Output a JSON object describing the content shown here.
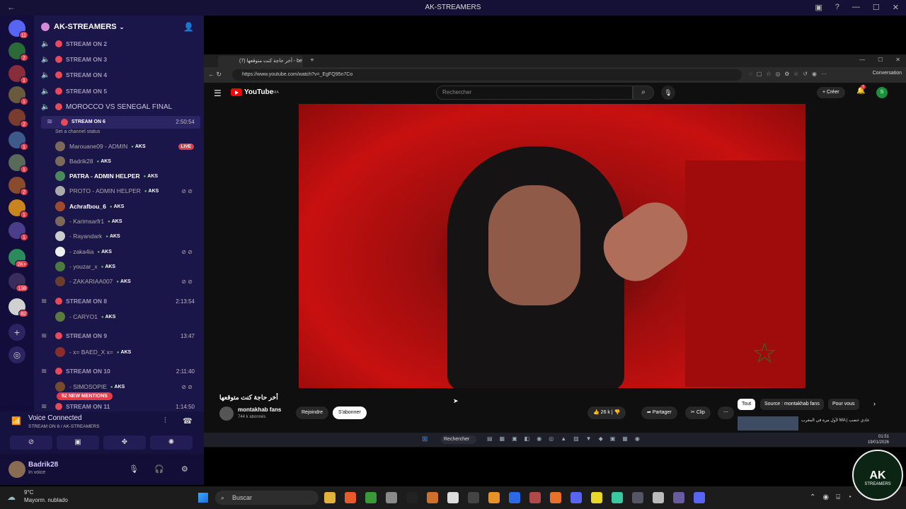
{
  "window": {
    "title": "AK-STREAMERS"
  },
  "servers": [
    {
      "badge": "11"
    },
    {
      "badge": "2"
    },
    {
      "badge": "1"
    },
    {
      "badge": "1"
    },
    {
      "badge": "2"
    },
    {
      "badge": "1"
    },
    {
      "badge": "1"
    },
    {
      "badge": "2"
    },
    {
      "badge": "1"
    },
    {
      "badge": "1"
    },
    {
      "badge": "2K+"
    },
    {
      "badge": "138"
    },
    {
      "badge": "82"
    }
  ],
  "guild": {
    "name": "AK-STREAMERS"
  },
  "channels": [
    {
      "name": "STREAM ON 2"
    },
    {
      "name": "STREAM ON 3"
    },
    {
      "name": "STREAM ON 4"
    },
    {
      "name": "STREAM ON 5"
    },
    {
      "name": "MOROCCO VS SENEGAL FINAL"
    }
  ],
  "active_channel": {
    "name": "STREAM ON 6",
    "time": "2:50:54",
    "status": "Set a channel status"
  },
  "users6": [
    {
      "name": "Marouane09 - ADMIN",
      "tag": "AKS",
      "live": "LIVE"
    },
    {
      "name": "Badrik28",
      "tag": "AKS"
    },
    {
      "name": "PATRA - ADMIN HELPER",
      "tag": "AKS"
    },
    {
      "name": "PROTO - ADMIN HELPER",
      "tag": "AKS"
    },
    {
      "name": "Achrafbou_6",
      "tag": "AKS"
    },
    {
      "name": "- Karimsarfr1",
      "tag": "AKS"
    },
    {
      "name": "- Rayandark",
      "tag": "AKS"
    },
    {
      "name": "- zaka4ia",
      "tag": "AKS"
    },
    {
      "name": "- youzar_x",
      "tag": "AKS"
    },
    {
      "name": "- ZAKARIAA007",
      "tag": "AKS"
    }
  ],
  "channel8": {
    "name": "STREAM ON 8",
    "time": "2:13:54",
    "user": "- CARYO1",
    "tag": "AKS"
  },
  "channel9": {
    "name": "STREAM ON 9",
    "time": "13:47",
    "user": "- x= BAED_X x=",
    "tag": "AKS"
  },
  "channel10": {
    "name": "STREAM ON 10",
    "time": "2:11:40",
    "user": "- SIMOSOPIE",
    "tag": "AKS"
  },
  "channel11": {
    "name": "STREAM ON 11",
    "time": "1:14:50"
  },
  "new_mentions": "52 NEW MENTIONS",
  "voice": {
    "title": "Voice Connected",
    "sub": "STREAM ON 6 / AK-STREAMERS"
  },
  "user": {
    "name": "Badrik28",
    "status": "In voice"
  },
  "browser": {
    "tab": "أخر حاجة كنت متوقعها (7) - be",
    "url": "https://www.youtube.com/watch?v=_EgFQ95n7Co",
    "conversation": "Conversation"
  },
  "youtube": {
    "logo": "YouTube",
    "region": "MA",
    "search_placeholder": "Rechercher",
    "create": "Créer",
    "notif": "7",
    "avatar": "S",
    "video_title": "أخر حاجة كنت متوقعها",
    "channel": "montakhab fans",
    "subscribers": "744 k abonnés",
    "join": "Rejoindre",
    "subscribe": "S'abonner",
    "likes": "26 k",
    "share": "Partager",
    "clip": "Clip",
    "chips": [
      "Tout",
      "Source : montakhab fans",
      "Pour vous"
    ],
    "related_title": "لأول مرة في المغرب MA | عادي خضب"
  },
  "inner_taskbar": {
    "search": "Rechercher",
    "time": "01:51",
    "date": "19/01/2026"
  },
  "taskbar": {
    "temp": "9°C",
    "weather": "Mayorm. nublado",
    "search": "Buscar"
  },
  "logo": {
    "text": "AK",
    "sub": "STREAMERS"
  }
}
